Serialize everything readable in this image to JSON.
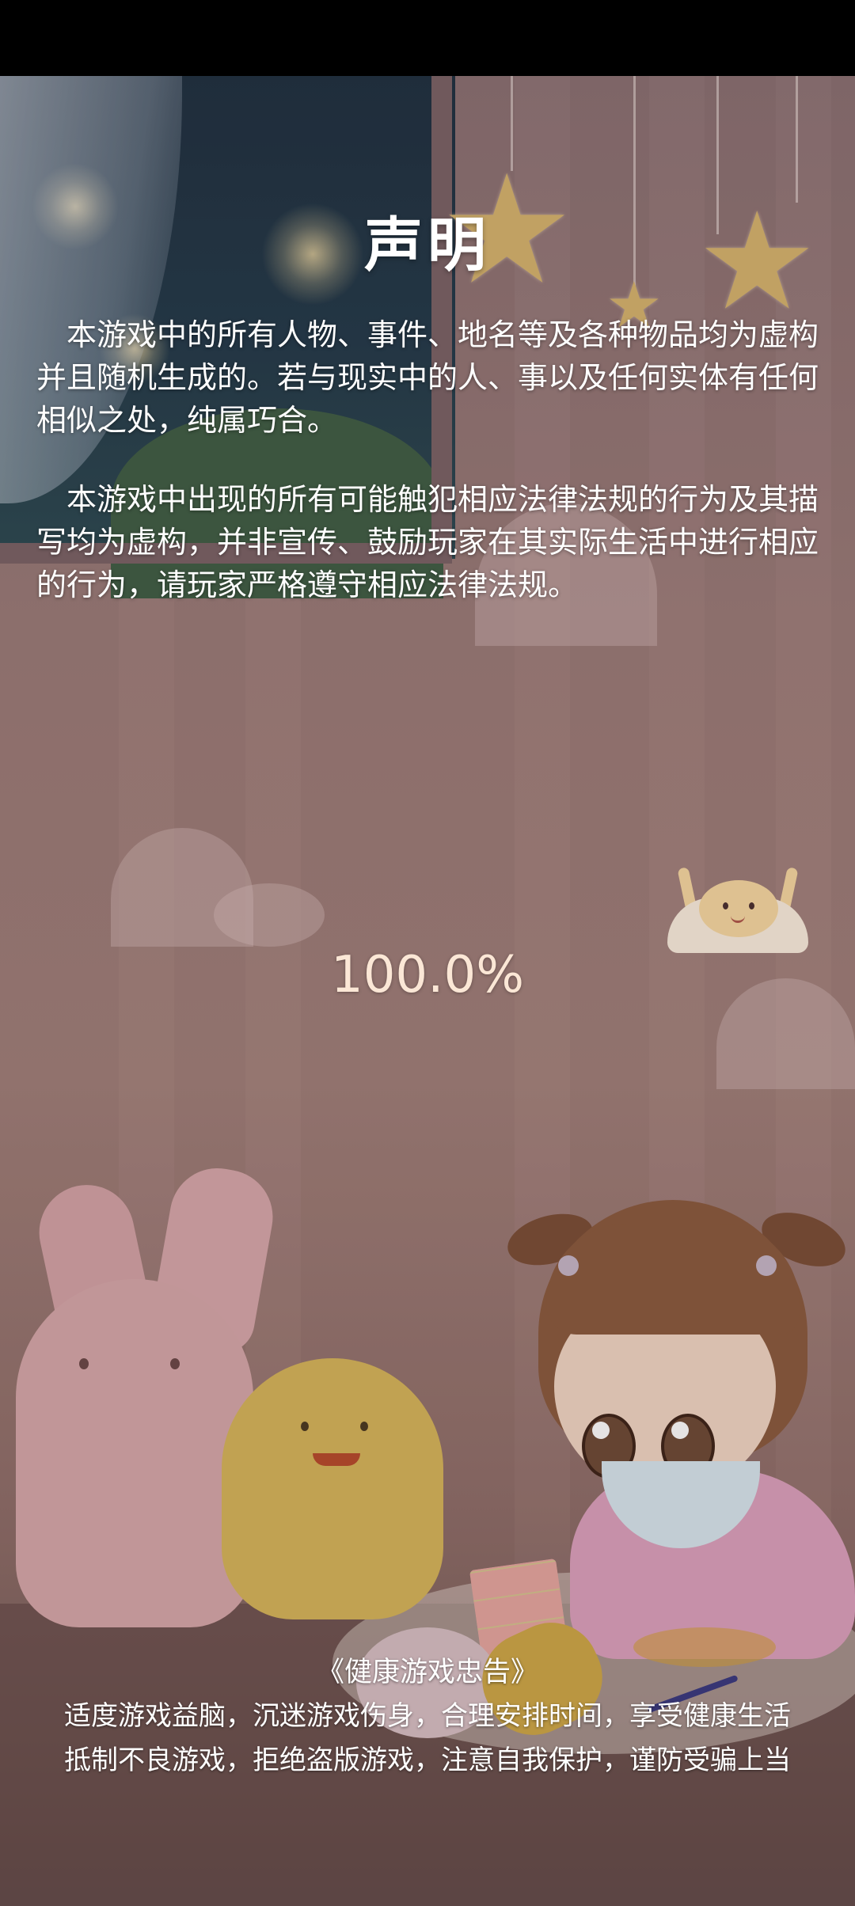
{
  "statement": {
    "title": "声明",
    "paragraph_1": "本游戏中的所有人物、事件、地名等及各种物品均为虚构并且随机生成的。若与现实中的人、事以及任何实体有任何相似之处，纯属巧合。",
    "paragraph_2": "本游戏中出现的所有可能触犯相应法律法规的行为及其描写均为虚构，并非宣传、鼓励玩家在其实际生活中进行相应的行为，请玩家严格遵守相应法律法规。"
  },
  "loading": {
    "progress_text": "100.0%",
    "progress_value": 100.0
  },
  "health_advice": {
    "title": "《健康游戏忠告》",
    "line_1": "适度游戏益脑，沉迷游戏伤身，合理安排时间，享受健康生活",
    "line_2": "抵制不良游戏，拒绝盗版游戏，注意自我保护，谨防受骗上当"
  },
  "icons": {
    "mascot": "cloud-mascot-icon",
    "stars": "hanging-star-icon"
  },
  "colors": {
    "text": "#ffffff",
    "progress_text": "#fbe7d6",
    "star": "#d7b46e"
  }
}
